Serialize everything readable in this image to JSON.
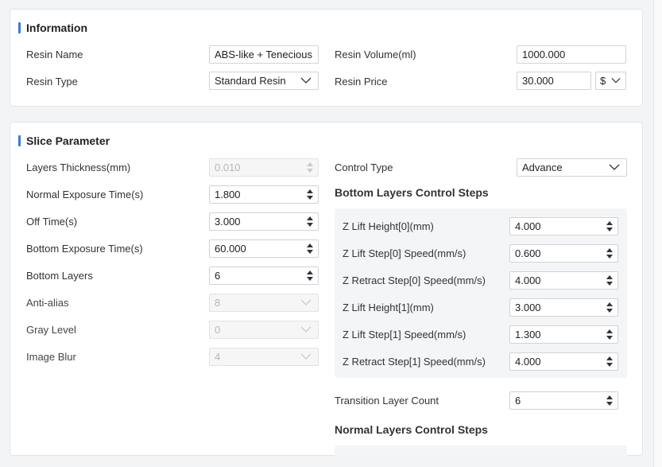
{
  "information": {
    "title": "Information",
    "resin_name_label": "Resin Name",
    "resin_name_value": "ABS-like + Tenecious",
    "resin_type_label": "Resin Type",
    "resin_type_value": "Standard Resin",
    "resin_volume_label": "Resin Volume(ml)",
    "resin_volume_value": "1000.000",
    "resin_price_label": "Resin Price",
    "resin_price_value": "30.000",
    "currency_value": "$"
  },
  "slice": {
    "title": "Slice Parameter",
    "layers_thickness_label": "Layers Thickness(mm)",
    "layers_thickness_value": "0.010",
    "normal_exposure_label": "Normal Exposure Time(s)",
    "normal_exposure_value": "1.800",
    "off_time_label": "Off Time(s)",
    "off_time_value": "3.000",
    "bottom_exposure_label": "Bottom Exposure Time(s)",
    "bottom_exposure_value": "60.000",
    "bottom_layers_label": "Bottom Layers",
    "bottom_layers_value": "6",
    "anti_alias_label": "Anti-alias",
    "anti_alias_value": "8",
    "gray_level_label": "Gray Level",
    "gray_level_value": "0",
    "image_blur_label": "Image Blur",
    "image_blur_value": "4",
    "control_type_label": "Control Type",
    "control_type_value": "Advance",
    "bottom_steps_title": "Bottom Layers Control Steps",
    "bottom_steps": [
      {
        "label": "Z Lift Height[0](mm)",
        "value": "4.000"
      },
      {
        "label": "Z Lift Step[0] Speed(mm/s)",
        "value": "0.600"
      },
      {
        "label": "Z Retract Step[0] Speed(mm/s)",
        "value": "4.000"
      },
      {
        "label": "Z Lift Height[1](mm)",
        "value": "3.000"
      },
      {
        "label": "Z Lift Step[1] Speed(mm/s)",
        "value": "1.300"
      },
      {
        "label": "Z Retract Step[1] Speed(mm/s)",
        "value": "4.000"
      }
    ],
    "transition_label": "Transition Layer Count",
    "transition_value": "6",
    "normal_steps_title": "Normal Layers Control Steps"
  }
}
